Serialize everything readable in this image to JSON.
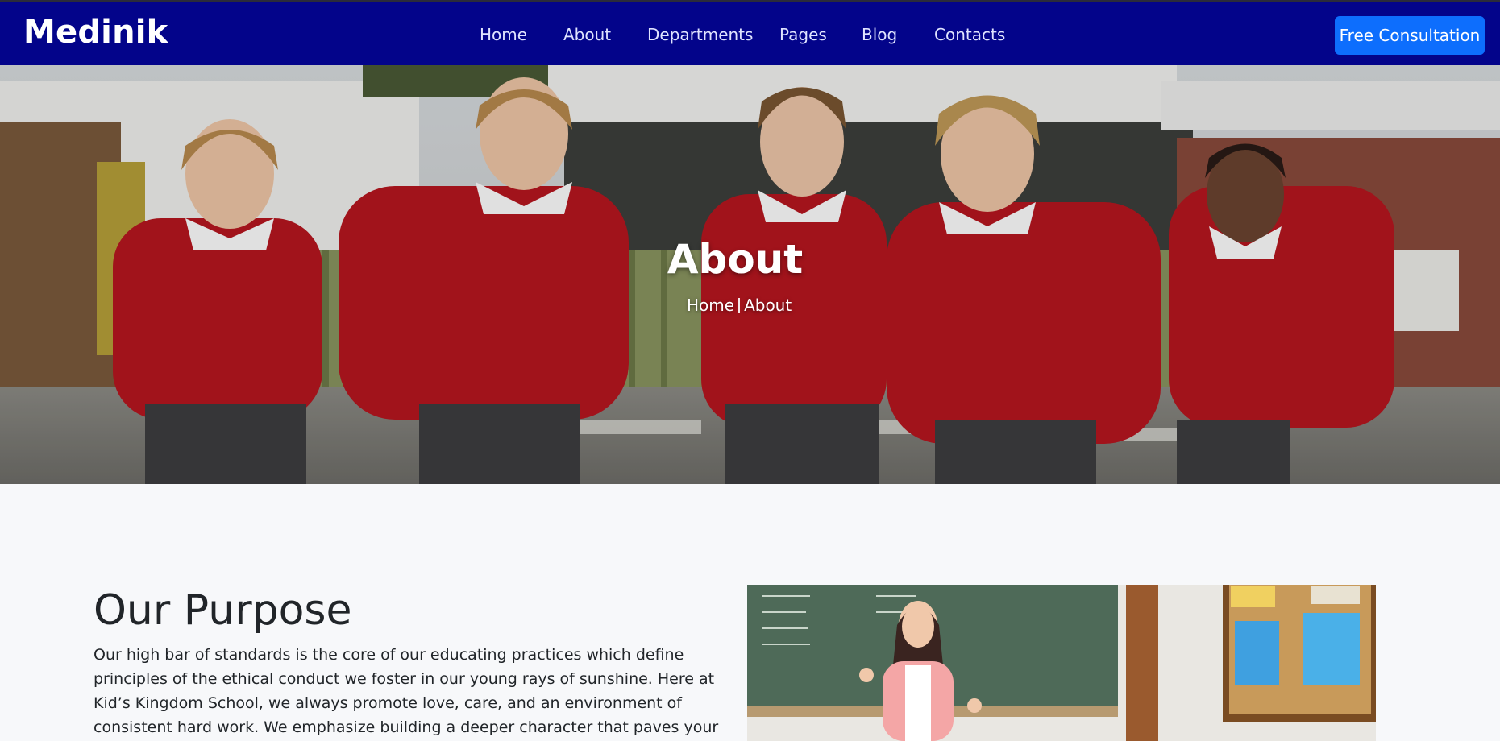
{
  "brand": {
    "name": "Medinik"
  },
  "nav": {
    "items": [
      {
        "label": "Home"
      },
      {
        "label": "About"
      },
      {
        "label": "Departments"
      },
      {
        "label": "Pages"
      },
      {
        "label": "Blog"
      },
      {
        "label": "Contacts"
      }
    ],
    "cta_label": "Free Consultation"
  },
  "hero": {
    "title": "About",
    "breadcrumb": {
      "home": "Home",
      "current": "About"
    }
  },
  "purpose": {
    "heading": "Our Purpose",
    "body": "Our high bar of standards is the core of our educating practices which define principles of the ethical conduct we foster in our young rays of sunshine. Here at Kid’s Kingdom School, we always promote love, care, and an environment of consistent hard work. We emphasize building a deeper character that paves your ward’s very first steps into the"
  },
  "colors": {
    "navbar": "#03048a",
    "cta": "#0d6efd",
    "page_background": "#f7f8fa"
  }
}
